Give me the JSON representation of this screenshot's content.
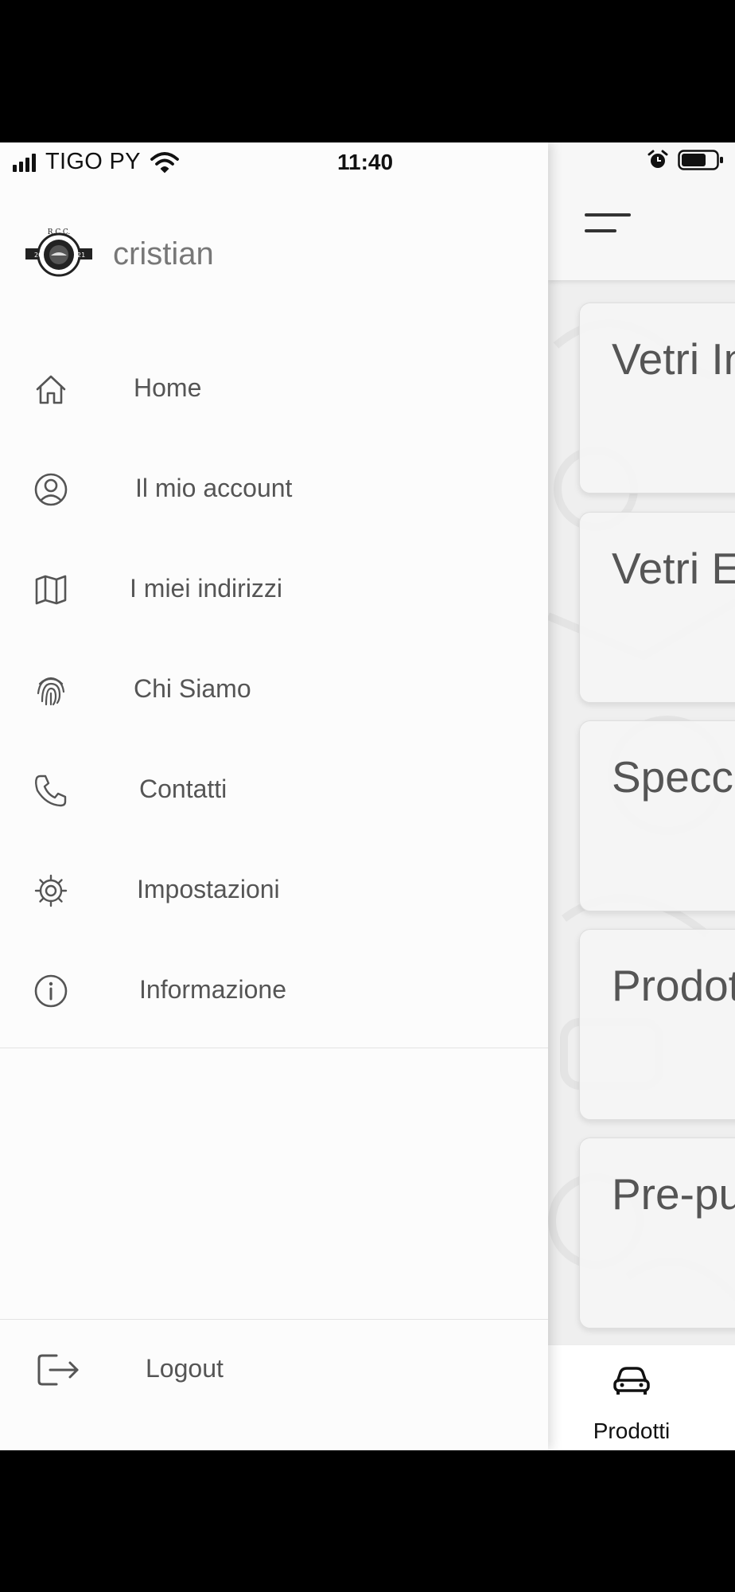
{
  "status_bar": {
    "carrier": "TIGO PY",
    "time": "11:40",
    "icons": [
      "signal-icon",
      "wifi-icon",
      "alarm-icon",
      "battery-icon"
    ]
  },
  "drawer": {
    "user_name": "cristian",
    "logo_icon": "rcc-logo",
    "menu": [
      {
        "label": "Home",
        "icon": "home-icon"
      },
      {
        "label": "Il mio account",
        "icon": "user-circle-icon"
      },
      {
        "label": "I miei indirizzi",
        "icon": "map-icon"
      },
      {
        "label": "Chi Siamo",
        "icon": "fingerprint-icon"
      },
      {
        "label": "Contatti",
        "icon": "phone-icon"
      },
      {
        "label": "Impostazioni",
        "icon": "gear-icon"
      },
      {
        "label": "Informazione",
        "icon": "info-icon"
      }
    ],
    "logout_label": "Logout"
  },
  "main": {
    "categories": [
      {
        "label": "Vetri In"
      },
      {
        "label": "Vetri E"
      },
      {
        "label": "Specc"
      },
      {
        "label": "Prodot"
      },
      {
        "label": "Pre-pu"
      }
    ],
    "tabbar": {
      "items": [
        {
          "label": "Prodotti",
          "icon": "car-icon"
        }
      ]
    }
  },
  "colors": {
    "drawer_bg": "#fcfcfc",
    "main_bg": "#efefef",
    "text_primary": "#555555",
    "icon_color": "#555555"
  }
}
